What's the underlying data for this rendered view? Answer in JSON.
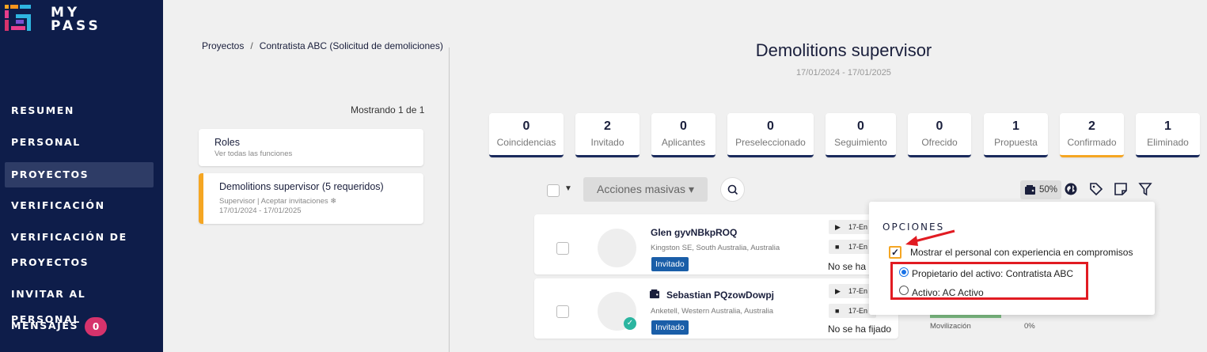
{
  "app": {
    "logo_line1": "MY",
    "logo_line2": "PASS"
  },
  "sidebar": {
    "items": [
      {
        "label": "RESUMEN"
      },
      {
        "label": "PERSONAL"
      },
      {
        "label": "PROYECTOS",
        "active": true
      },
      {
        "label": "VERIFICACIÓN"
      },
      {
        "label": "VERIFICACIÓN DE"
      },
      {
        "label": "PROYECTOS"
      },
      {
        "label": "INVITAR AL PERSONAL"
      },
      {
        "label": "MENSAJES"
      }
    ],
    "messages_count": "0"
  },
  "breadcrumb": {
    "root": "Proyectos",
    "separator": "/",
    "current": "Contratista ABC (Solicitud de demoliciones)"
  },
  "left": {
    "showing": "Mostrando 1 de 1",
    "roles_card": {
      "title": "Roles",
      "subtitle": "Ver todas las funciones"
    },
    "role_card": {
      "title": "Demolitions supervisor (5 requeridos)",
      "subtitle": "Supervisor | Aceptar invitaciones ❄",
      "dates": "17/01/2024 - 17/01/2025"
    }
  },
  "header": {
    "title": "Demolitions supervisor",
    "dates": "17/01/2024 - 17/01/2025"
  },
  "stats": [
    {
      "value": "0",
      "label": "Coincidencias"
    },
    {
      "value": "2",
      "label": "Invitado"
    },
    {
      "value": "0",
      "label": "Aplicantes"
    },
    {
      "value": "0",
      "label": "Preseleccionado"
    },
    {
      "value": "0",
      "label": "Seguimiento"
    },
    {
      "value": "0",
      "label": "Ofrecido"
    },
    {
      "value": "1",
      "label": "Propuesta"
    },
    {
      "value": "2",
      "label": "Confirmado"
    },
    {
      "value": "1",
      "label": "Eliminado"
    }
  ],
  "toolbar": {
    "bulk_actions": "Acciones masivas",
    "percent": "50%"
  },
  "rows": [
    {
      "name": "Glen gyvNBkpROQ",
      "location": "Kingston SE, South Australia, Australia",
      "tag": "Invitado",
      "event1": "17-En",
      "event2": "17-En",
      "status": "No se ha"
    },
    {
      "name": "Sebastian PQzowDowpj",
      "location": "Anketell, Western Australia, Australia",
      "tag": "Invitado",
      "event1": "17-En",
      "event2": "17-En",
      "status": "No se ha fijado",
      "mobilization_label": "Movilización",
      "mobilization_pct": "0%"
    }
  ],
  "options": {
    "title": "OPCIONES",
    "checkbox_label": "Mostrar el personal con experiencia en compromisos",
    "radio1": "Propietario del activo: Contratista ABC",
    "radio2": "Activo: AC Activo"
  },
  "colors": {
    "sidebar": "#0e1d4a",
    "accent_orange": "#f5a623",
    "highlight_red": "#e11b22",
    "tag_blue": "#1a5ea8"
  }
}
